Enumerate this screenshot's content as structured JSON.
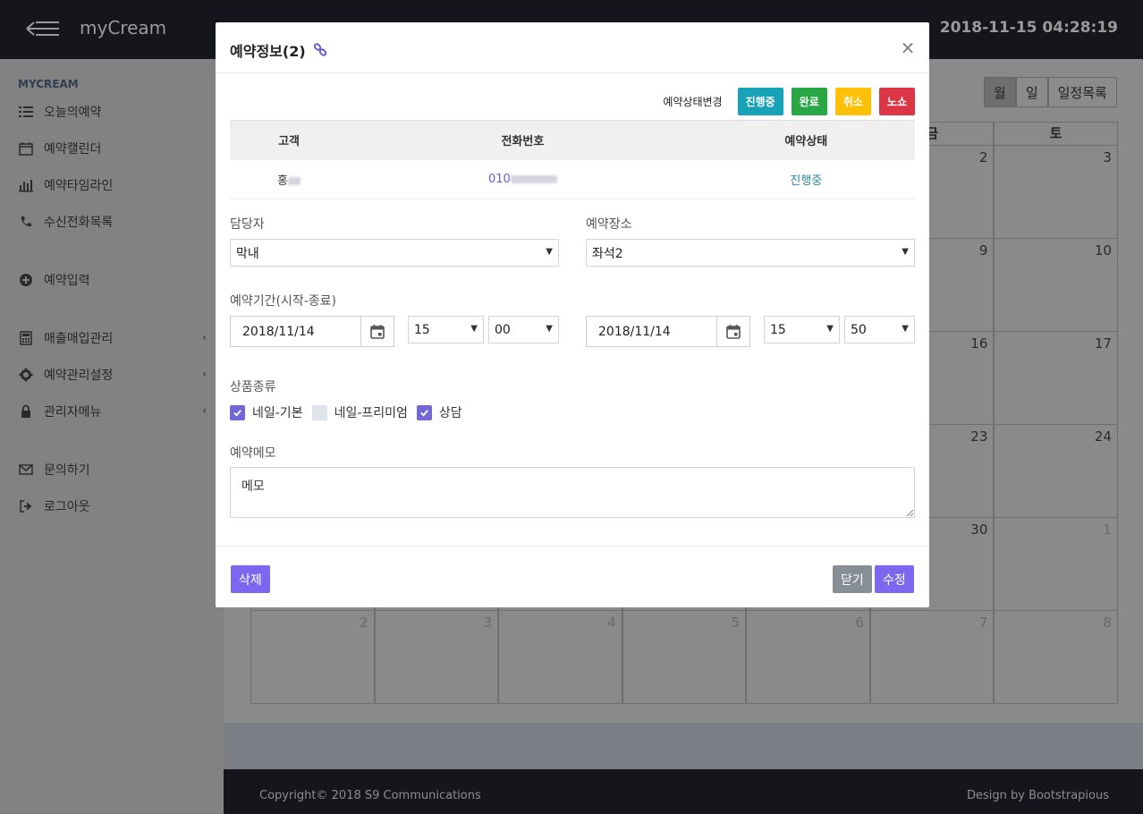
{
  "app": {
    "brand": "myCream",
    "clock": "2018-11-15 04:28:19"
  },
  "sidebar": {
    "heading": "MYCREAM",
    "items": [
      {
        "label": "오늘의예약",
        "icon": "list-icon"
      },
      {
        "label": "예약캘린더",
        "icon": "calendar-icon"
      },
      {
        "label": "예약타임라인",
        "icon": "bar-chart-icon"
      },
      {
        "label": "수신전화목록",
        "icon": "phone-icon"
      },
      {
        "label": "예약입력",
        "icon": "plus-circle-icon"
      },
      {
        "label": "매출매입관리",
        "icon": "calculator-icon",
        "chevron": "‹"
      },
      {
        "label": "예약관리설정",
        "icon": "gear-icon",
        "chevron": "‹"
      },
      {
        "label": "관리자메뉴",
        "icon": "lock-icon",
        "chevron": "‹"
      },
      {
        "label": "문의하기",
        "icon": "envelope-icon"
      },
      {
        "label": "로그아웃",
        "icon": "sign-out-icon"
      }
    ]
  },
  "calendar": {
    "views": [
      "월",
      "일",
      "일정목록"
    ],
    "headers": [
      "",
      "",
      "",
      "",
      "",
      "금",
      "토"
    ],
    "rows": [
      [
        "",
        "",
        "",
        "",
        "",
        "2",
        "3"
      ],
      [
        "",
        "",
        "",
        "",
        "",
        "9",
        "10"
      ],
      [
        "",
        "",
        "",
        "",
        "",
        "16",
        "17"
      ],
      [
        "",
        "",
        "",
        "",
        "",
        "23",
        "24"
      ],
      [
        "",
        "",
        "",
        "",
        "",
        "30",
        "1"
      ],
      [
        "2",
        "3",
        "4",
        "5",
        "6",
        "7",
        "8"
      ]
    ]
  },
  "footer": {
    "copyright": "Copyright© 2018 S9 Communications",
    "credit": "Design by Bootstrapious"
  },
  "modal": {
    "title": "예약정보(2)",
    "status_label": "예약상태변경",
    "status_buttons": [
      {
        "label": "진행중",
        "color": "#17a2b8"
      },
      {
        "label": "완료",
        "color": "#28a745"
      },
      {
        "label": "취소",
        "color": "#ffc107"
      },
      {
        "label": "노쇼",
        "color": "#dc3545"
      }
    ],
    "table": {
      "headers": [
        "고객",
        "전화번호",
        "예약상태"
      ],
      "customer": "홍",
      "phone": "010",
      "status": "진행중"
    },
    "staff": {
      "label": "담당자",
      "value": "막내"
    },
    "place": {
      "label": "예약장소",
      "value": "좌석2"
    },
    "period": {
      "label": "예약기간(시작-종료)",
      "start_date": "2018/11/14",
      "start_hour": "15",
      "start_min": "00",
      "end_date": "2018/11/14",
      "end_hour": "15",
      "end_min": "50"
    },
    "products": {
      "label": "상품종류",
      "items": [
        {
          "label": "네일-기본",
          "checked": true
        },
        {
          "label": "네일-프리미엄",
          "checked": false
        },
        {
          "label": "상담",
          "checked": true
        }
      ]
    },
    "memo": {
      "label": "예약메모",
      "value": "메모"
    },
    "buttons": {
      "delete": "삭제",
      "close": "닫기",
      "save": "수정",
      "delete_color": "#7b68ee",
      "close_color": "#868e96",
      "save_color": "#7b68ee"
    }
  }
}
